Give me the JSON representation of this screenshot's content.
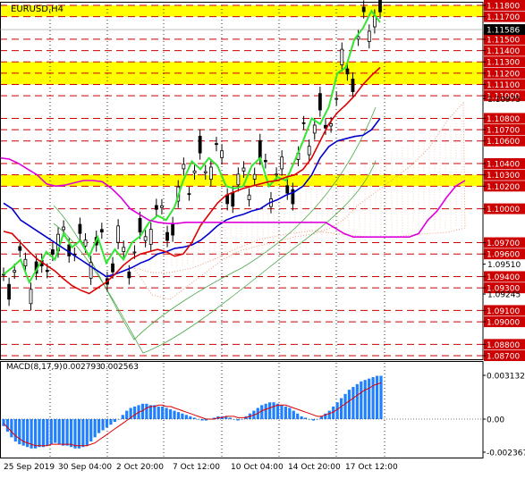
{
  "symbol_label": "EURUSD,H4",
  "chart_data": {
    "type": "line",
    "title": "EURUSD,H4",
    "main": {
      "ylim": [
        1.087,
        1.118
      ],
      "current_price": "1.11586",
      "level_lines": [
        {
          "price": 1.118,
          "label": "1.11800"
        },
        {
          "price": 1.117,
          "label": "1.11700"
        },
        {
          "price": 1.115,
          "label": "1.11500"
        },
        {
          "price": 1.114,
          "label": "1.11400"
        },
        {
          "price": 1.113,
          "label": "1.11300"
        },
        {
          "price": 1.112,
          "label": "1.11200"
        },
        {
          "price": 1.111,
          "label": "1.11100"
        },
        {
          "price": 1.11,
          "label": "1.11000"
        },
        {
          "price": 1.108,
          "label": "1.10800"
        },
        {
          "price": 1.107,
          "label": "1.10700"
        },
        {
          "price": 1.106,
          "label": "1.10600"
        },
        {
          "price": 1.104,
          "label": "1.10400"
        },
        {
          "price": 1.103,
          "label": "1.10300"
        },
        {
          "price": 1.102,
          "label": "1.10200"
        },
        {
          "price": 1.1,
          "label": "1.10000"
        },
        {
          "price": 1.097,
          "label": "1.09700"
        },
        {
          "price": 1.096,
          "label": "1.09600"
        },
        {
          "price": 1.094,
          "label": "1.09400"
        },
        {
          "price": 1.093,
          "label": "1.09300"
        },
        {
          "price": 1.091,
          "label": "1.09100"
        },
        {
          "price": 1.09,
          "label": "1.09000"
        },
        {
          "price": 1.088,
          "label": "1.08800"
        },
        {
          "price": 1.087,
          "label": "1.08700"
        }
      ],
      "plain_ticks": [
        {
          "price": 1.10975,
          "label": "1.10975"
        },
        {
          "price": 1.0951,
          "label": "1.09510"
        },
        {
          "price": 1.09245,
          "label": "1.09245"
        }
      ],
      "zones": [
        {
          "from": 1.117,
          "to": 1.118
        },
        {
          "from": 1.111,
          "to": 1.113
        },
        {
          "from": 1.102,
          "to": 1.103
        }
      ],
      "series": [
        {
          "name": "",
          "color": "#32e632",
          "values": [
            1.0942,
            1.0948,
            1.0955,
            1.0935,
            1.0948,
            1.0962,
            1.0955,
            1.0978,
            1.0966,
            1.0972,
            1.0958,
            1.0975,
            1.0952,
            1.0964,
            1.0955,
            1.097,
            1.0976,
            1.0988,
            1.0994,
            1.099,
            1.1002,
            1.1025,
            1.1042,
            1.1035,
            1.1045,
            1.1038,
            1.102,
            1.1018,
            1.102,
            1.1038,
            1.1045,
            1.102,
            1.1028,
            1.1025,
            1.1042,
            1.106,
            1.108,
            1.1075,
            1.109,
            1.112,
            1.1125,
            1.115,
            1.116,
            1.1175,
            1.1165
          ]
        },
        {
          "name": "",
          "color": "#0000cc",
          "values": [
            1.1005,
            1.1,
            1.099,
            1.0985,
            1.098,
            1.0975,
            1.097,
            1.0965,
            1.096,
            1.0955,
            1.095,
            1.0945,
            1.094,
            1.0942,
            1.0945,
            1.0948,
            1.0952,
            1.0955,
            1.096,
            1.0962,
            1.0965,
            1.0966,
            1.0968,
            1.0972,
            1.0978,
            1.0985,
            1.099,
            1.0993,
            1.0995,
            1.0998,
            1.1,
            1.1005,
            1.1008,
            1.1012,
            1.1015,
            1.102,
            1.103,
            1.1045,
            1.1055,
            1.106,
            1.1062,
            1.1064,
            1.1065,
            1.107,
            1.108
          ]
        },
        {
          "name": "",
          "color": "#dd0000",
          "values": [
            1.098,
            1.0978,
            1.097,
            1.0962,
            1.0955,
            1.095,
            1.0945,
            1.0938,
            1.0932,
            1.0928,
            1.0925,
            1.093,
            1.0935,
            1.0942,
            1.095,
            1.0956,
            1.096,
            1.0962,
            1.0964,
            1.0962,
            1.0958,
            1.096,
            1.097,
            1.0985,
            1.0995,
            1.1005,
            1.1012,
            1.1015,
            1.1018,
            1.102,
            1.1022,
            1.1024,
            1.1025,
            1.1028,
            1.103,
            1.1035,
            1.1045,
            1.106,
            1.1075,
            1.1085,
            1.1092,
            1.11,
            1.111,
            1.1118,
            1.1125
          ]
        },
        {
          "name": "",
          "color": "#dd00dd",
          "values": [
            1.1045,
            1.1044,
            1.104,
            1.1035,
            1.103,
            1.1022,
            1.102,
            1.1021,
            1.1023,
            1.1025,
            1.1025,
            1.1024,
            1.1018,
            1.101,
            1.1,
            1.0995,
            1.099,
            1.0988,
            1.0987,
            1.0987,
            1.0988,
            1.0988,
            1.0988,
            1.0988,
            1.0988,
            1.0988,
            1.0988,
            1.0988,
            1.0988,
            1.0988,
            1.0988,
            1.0988,
            1.0988,
            1.0988,
            1.0988,
            1.0988,
            1.0983,
            1.0978,
            1.0975,
            1.0975,
            1.0975,
            1.0975,
            1.0975,
            1.0975,
            1.0975,
            1.0978,
            1.099,
            1.0998,
            1.101,
            1.102,
            1.1025
          ]
        }
      ],
      "bar_count": 45
    },
    "macd": {
      "label": "MACD(8,17,9)",
      "main_value": "0.002793",
      "signal_value": "0.002563",
      "ylim": [
        -0.002367,
        0.003132
      ],
      "ticks": [
        {
          "value": 0.003132,
          "label": "0.003132"
        },
        {
          "value": 0.0,
          "label": "0.00"
        },
        {
          "value": -0.002367,
          "label": "-0.002367"
        }
      ],
      "histogram": [
        -0.0005,
        -0.0009,
        -0.0013,
        -0.0016,
        -0.0018,
        -0.0019,
        -0.002,
        -0.0021,
        -0.0021,
        -0.002,
        -0.002,
        -0.0019,
        -0.0018,
        -0.0017,
        -0.0018,
        -0.0019,
        -0.0019,
        -0.002,
        -0.0021,
        -0.0021,
        -0.002,
        -0.0019,
        -0.0016,
        -0.0013,
        -0.001,
        -0.0008,
        -0.0006,
        -0.0004,
        -0.0002,
        0.0,
        0.0003,
        0.0006,
        0.0008,
        0.0009,
        0.001,
        0.0011,
        0.0011,
        0.001,
        0.001,
        0.0009,
        0.0009,
        0.0008,
        0.0007,
        0.0006,
        0.0005,
        0.0004,
        0.0003,
        0.0002,
        0.0001,
        0.0,
        -0.0001,
        -0.0001,
        0.0,
        0.0001,
        0.0002,
        0.0002,
        0.0002,
        0.0001,
        0.0,
        -0.0001,
        0.0,
        0.0002,
        0.0004,
        0.0006,
        0.0008,
        0.001,
        0.0011,
        0.0012,
        0.0012,
        0.0011,
        0.001,
        0.0009,
        0.0008,
        0.0006,
        0.0004,
        0.0002,
        0.0001,
        0.0,
        -0.0001,
        0.0,
        0.0002,
        0.0004,
        0.0006,
        0.0009,
        0.0012,
        0.0015,
        0.0018,
        0.0021,
        0.0023,
        0.0025,
        0.0027,
        0.0028,
        0.0029,
        0.003,
        0.0031,
        0.0031
      ],
      "signal": [
        -0.0003,
        -0.0006,
        -0.0009,
        -0.0012,
        -0.0014,
        -0.0016,
        -0.0017,
        -0.0018,
        -0.0019,
        -0.0019,
        -0.0019,
        -0.0019,
        -0.0018,
        -0.0018,
        -0.0018,
        -0.0018,
        -0.0018,
        -0.0018,
        -0.0019,
        -0.0019,
        -0.0019,
        -0.0019,
        -0.0018,
        -0.0017,
        -0.0015,
        -0.0013,
        -0.0011,
        -0.0009,
        -0.0007,
        -0.0005,
        -0.0003,
        -0.0001,
        0.0001,
        0.0003,
        0.0005,
        0.0006,
        0.0008,
        0.0009,
        0.0009,
        0.001,
        0.001,
        0.0009,
        0.0009,
        0.0008,
        0.0007,
        0.0006,
        0.0005,
        0.0004,
        0.0003,
        0.0002,
        0.0001,
        0.0,
        0.0,
        0.0,
        0.0001,
        0.0001,
        0.0002,
        0.0002,
        0.0002,
        0.0001,
        0.0001,
        0.0001,
        0.0002,
        0.0003,
        0.0004,
        0.0006,
        0.0007,
        0.0008,
        0.0009,
        0.001,
        0.001,
        0.001,
        0.0009,
        0.0008,
        0.0007,
        0.0006,
        0.0005,
        0.0004,
        0.0003,
        0.0002,
        0.0002,
        0.0003,
        0.0004,
        0.0005,
        0.0007,
        0.0009,
        0.0011,
        0.0013,
        0.0015,
        0.0017,
        0.0019,
        0.0021,
        0.0022,
        0.0024,
        0.0025,
        0.0026
      ]
    },
    "x_tick_labels": [
      "25 Sep 2019",
      "30 Sep 04:00",
      "2 Oct 20:00",
      "7 Oct 12:00",
      "10 Oct 04:00",
      "14 Oct 20:00",
      "17 Oct 12:00"
    ],
    "colors": {
      "zone": "#ffff00",
      "level_line": "#cc0000",
      "ichimoku_cloud": "#e8a080",
      "bands": "#48a848"
    }
  }
}
